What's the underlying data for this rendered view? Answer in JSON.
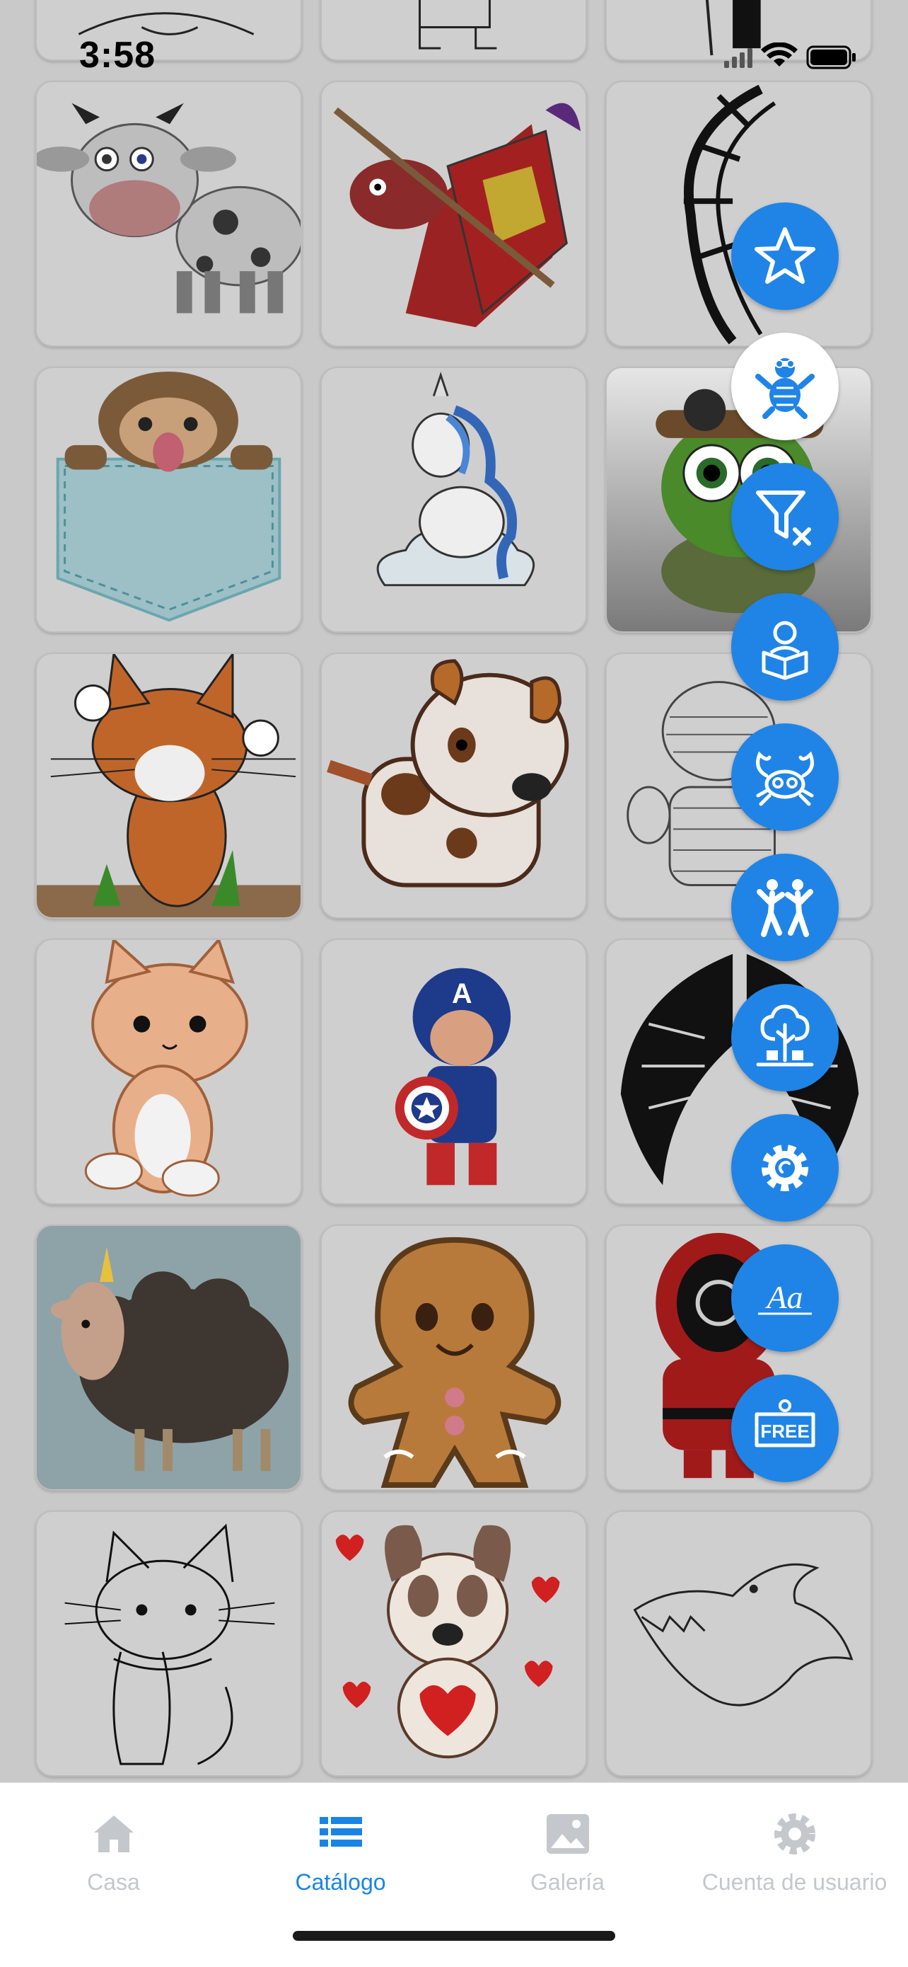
{
  "status": {
    "time": "3:58"
  },
  "tiles": [
    {
      "icon": "princess-drawing"
    },
    {
      "icon": "boy-drawing"
    },
    {
      "icon": "person-drawing"
    },
    {
      "icon": "cow-drawing"
    },
    {
      "icon": "knight-horse-drawing"
    },
    {
      "icon": "dragon-head-drawing"
    },
    {
      "icon": "sloth-pocket-drawing"
    },
    {
      "icon": "unicorn-cloud-drawing"
    },
    {
      "icon": "turtle-pilot-drawing"
    },
    {
      "icon": "fox-drawing"
    },
    {
      "icon": "puppy-drawing"
    },
    {
      "icon": "mummy-drawing"
    },
    {
      "icon": "cat-drawing"
    },
    {
      "icon": "captain-america-drawing"
    },
    {
      "icon": "wings-drawing"
    },
    {
      "icon": "sheep-drawing"
    },
    {
      "icon": "gingerbread-drawing"
    },
    {
      "icon": "squid-game-guard-drawing"
    },
    {
      "icon": "sketch-cat-drawing"
    },
    {
      "icon": "bulldog-hearts-drawing"
    },
    {
      "icon": "dragon-sketch-drawing"
    }
  ],
  "fabs": [
    {
      "icon": "star-icon"
    },
    {
      "icon": "turtle-icon"
    },
    {
      "icon": "filter-clear-icon"
    },
    {
      "icon": "reader-icon"
    },
    {
      "icon": "crab-icon"
    },
    {
      "icon": "dancing-people-icon"
    },
    {
      "icon": "nature-tree-icon"
    },
    {
      "icon": "settings-gear-icon"
    },
    {
      "icon": "font-aa-icon",
      "label": "Aa"
    },
    {
      "icon": "free-sign-icon",
      "label": "FREE"
    }
  ],
  "tabs": [
    {
      "label": "Casa",
      "icon": "home-icon",
      "active": false
    },
    {
      "label": "Catálogo",
      "icon": "list-icon",
      "active": true
    },
    {
      "label": "Galería",
      "icon": "image-icon",
      "active": false
    },
    {
      "label": "Cuenta de usuario",
      "icon": "gear-icon",
      "active": false
    }
  ],
  "colors": {
    "accent": "#1a84e6",
    "fab": "#1f84e6",
    "overlay_background": "#c9c9c9",
    "inactive_tab": "#c4c8cc"
  }
}
